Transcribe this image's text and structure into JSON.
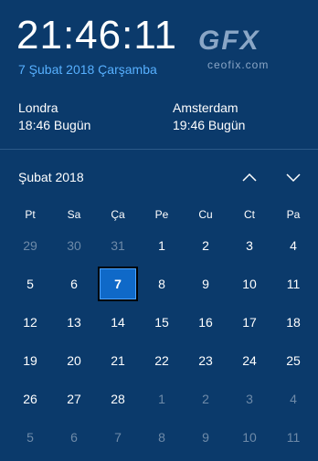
{
  "clock": {
    "time": "21:46:11",
    "date": "7 Şubat 2018 Çarşamba"
  },
  "logo": {
    "mark": "GFX",
    "text": "ceofix.com"
  },
  "additional_clocks": [
    {
      "city": "Londra",
      "time": "18:46 Bugün"
    },
    {
      "city": "Amsterdam",
      "time": "19:46 Bugün"
    }
  ],
  "calendar": {
    "month_title": "Şubat 2018",
    "weekdays": [
      "Pt",
      "Sa",
      "Ça",
      "Pe",
      "Cu",
      "Ct",
      "Pa"
    ],
    "weeks": [
      [
        "29",
        "30",
        "31",
        "1",
        "2",
        "3",
        "4"
      ],
      [
        "5",
        "6",
        "7",
        "8",
        "9",
        "10",
        "11"
      ],
      [
        "12",
        "13",
        "14",
        "15",
        "16",
        "17",
        "18"
      ],
      [
        "19",
        "20",
        "21",
        "22",
        "23",
        "24",
        "25"
      ],
      [
        "26",
        "27",
        "28",
        "1",
        "2",
        "3",
        "4"
      ],
      [
        "5",
        "6",
        "7",
        "8",
        "9",
        "10",
        "11"
      ]
    ],
    "other_month_cells": [
      [
        0,
        0
      ],
      [
        0,
        1
      ],
      [
        0,
        2
      ],
      [
        4,
        3
      ],
      [
        4,
        4
      ],
      [
        4,
        5
      ],
      [
        4,
        6
      ],
      [
        5,
        0
      ],
      [
        5,
        1
      ],
      [
        5,
        2
      ],
      [
        5,
        3
      ],
      [
        5,
        4
      ],
      [
        5,
        5
      ],
      [
        5,
        6
      ]
    ],
    "today_cell": [
      1,
      2
    ],
    "nav": {
      "prev_icon": "chevron-up-icon",
      "next_icon": "chevron-down-icon"
    }
  },
  "colors": {
    "background": "#0b3a6b",
    "accent": "#57b0ff",
    "today": "#0f69c8",
    "muted": "#6e8aa8"
  }
}
